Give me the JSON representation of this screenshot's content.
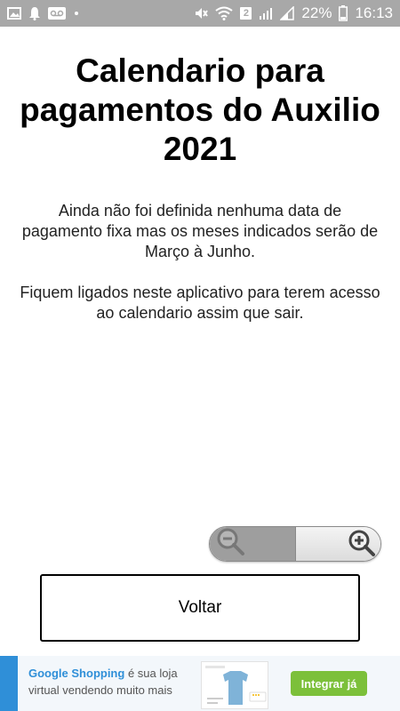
{
  "status_bar": {
    "sim_badge": "2",
    "battery_percent": "22%",
    "time": "16:13",
    "icons": [
      "image-icon",
      "bell-icon",
      "voicemail-icon",
      "mute-icon",
      "wifi-icon",
      "signal-icon",
      "signal-icon",
      "battery-icon"
    ]
  },
  "page": {
    "title": "Calendario para pagamentos do Auxilio 2021",
    "paragraph1": "Ainda não foi definida nenhuma data de pagamento fixa mas os meses indicados serão de Março à Junho.",
    "paragraph2": "Fiquem ligados neste aplicativo para terem acesso ao calendario assim que sair."
  },
  "zoom_control": {
    "zoom_out_icon": "zoom-out-icon",
    "zoom_in_icon": "zoom-in-icon"
  },
  "buttons": {
    "back_label": "Voltar"
  },
  "ad": {
    "brand": "Google Shopping",
    "text": "é sua loja virtual vendendo muito mais",
    "cta_label": "Integrar já",
    "accent_color": "#2f8fd8",
    "cta_color": "#7cc03a"
  }
}
